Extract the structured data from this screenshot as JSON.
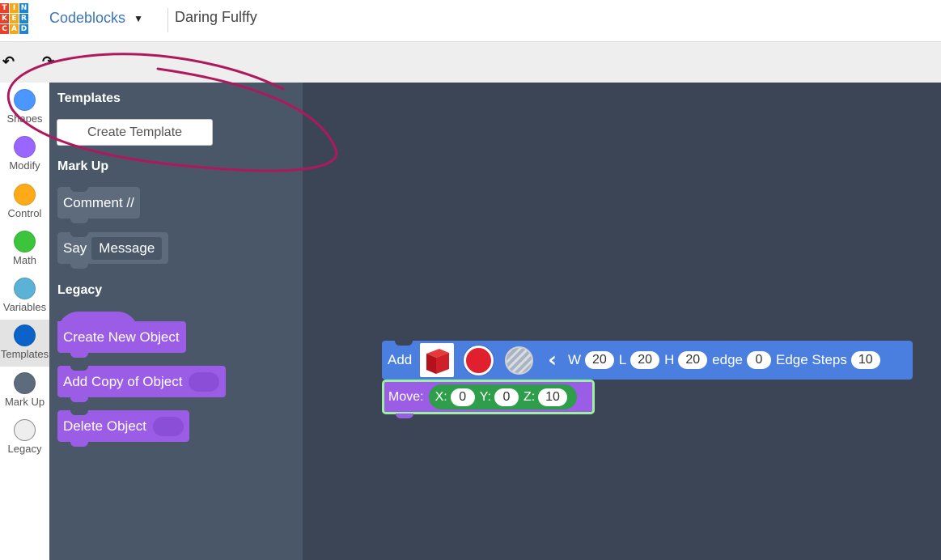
{
  "header": {
    "logo_letters": [
      "T",
      "I",
      "N",
      "K",
      "E",
      "R",
      "C",
      "A",
      "D"
    ],
    "logo_colors": [
      "#e8412b",
      "#f2a81d",
      "#1d85d0",
      "#e8412b",
      "#f2a81d",
      "#1d85d0",
      "#e8412b",
      "#f2a81d",
      "#1d85d0"
    ],
    "app_name": "Codeblocks",
    "design_name": "Daring Fulffy"
  },
  "toolbar": {
    "undo_icon": "undo-icon",
    "redo_icon": "redo-icon"
  },
  "categories": [
    {
      "label": "Shapes",
      "color": "#4c97ff"
    },
    {
      "label": "Modify",
      "color": "#9966ff"
    },
    {
      "label": "Control",
      "color": "#ffab19"
    },
    {
      "label": "Math",
      "color": "#3cc43c"
    },
    {
      "label": "Variables",
      "color": "#5cb1d6"
    },
    {
      "label": "Templates",
      "color": "#0b62c9",
      "active": true
    },
    {
      "label": "Mark Up",
      "color": "#5d6b7d"
    },
    {
      "label": "Legacy",
      "color": "#eeeeee"
    }
  ],
  "flyout": {
    "templates_title": "Templates",
    "create_template_label": "Create Template",
    "markup_title": "Mark Up",
    "comment_label": "Comment //",
    "say_label": "Say",
    "say_message": "Message",
    "legacy_title": "Legacy",
    "create_new_object_label": "Create New Object",
    "add_copy_label": "Add Copy of Object",
    "delete_object_label": "Delete Object"
  },
  "workspace": {
    "add_block": {
      "label": "Add",
      "color_value": "#e0202e",
      "w_label": "W",
      "w_value": "20",
      "l_label": "L",
      "l_value": "20",
      "h_label": "H",
      "h_value": "20",
      "edge_label": "edge",
      "edge_value": "0",
      "steps_label": "Edge Steps",
      "steps_value": "10"
    },
    "move_block": {
      "label": "Move:",
      "x_label": "X:",
      "x_value": "0",
      "y_label": "Y:",
      "y_value": "0",
      "z_label": "Z:",
      "z_value": "10"
    }
  },
  "annotation": {
    "color": "#b0185e"
  }
}
